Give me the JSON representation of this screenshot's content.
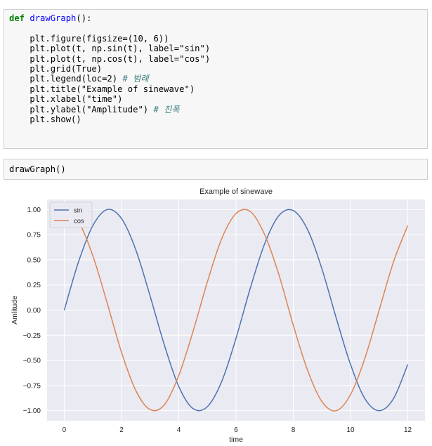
{
  "code_cell": {
    "def_kw": "def",
    "func_name": "drawGraph",
    "def_tail": "():",
    "l1": "plt.figure(figsize=(10, 6))",
    "l2": "plt.plot(t, np.sin(t), label=\"sin\")",
    "l3": "plt.plot(t, np.cos(t), label=\"cos\")",
    "l4": "plt.grid(True)",
    "l5_code": "plt.legend(loc=2) ",
    "l5_comment": "# 범례",
    "l6": "plt.title(\"Example of sinewave\")",
    "l7": "plt.xlabel(\"time\")",
    "l8_code": "plt.ylabel(\"Amplitude\") ",
    "l8_comment": "# 진폭",
    "l9": "plt.show()"
  },
  "run_cell": {
    "code": "drawGraph()"
  },
  "colors": {
    "sin": "#4c72b0",
    "cos": "#dd8452",
    "plot_bg": "#eaeaf2",
    "grid": "#ffffff"
  },
  "chart_data": {
    "type": "line",
    "title": "Example of sinewave",
    "xlabel": "time",
    "ylabel": "Amlitude",
    "xlim": [
      -0.6,
      12.6
    ],
    "ylim": [
      -1.1,
      1.1
    ],
    "xticks": [
      0,
      2,
      4,
      6,
      8,
      10,
      12
    ],
    "xtick_labels": [
      "0",
      "2",
      "4",
      "6",
      "8",
      "10",
      "12"
    ],
    "yticks": [
      -1.0,
      -0.75,
      -0.5,
      -0.25,
      0.0,
      0.25,
      0.5,
      0.75,
      1.0
    ],
    "ytick_labels": [
      "−1.00",
      "−0.75",
      "−0.50",
      "−0.25",
      "0.00",
      "0.25",
      "0.50",
      "0.75",
      "1.00"
    ],
    "grid": true,
    "legend_position": "top-left",
    "series": [
      {
        "name": "sin",
        "color": "#4c72b0",
        "x": [
          0,
          0.5,
          1,
          1.5,
          2,
          2.5,
          3,
          3.5,
          4,
          4.5,
          5,
          5.5,
          6,
          6.5,
          7,
          7.5,
          8,
          8.5,
          9,
          9.5,
          10,
          10.5,
          11,
          11.5,
          12
        ],
        "y": [
          0.0,
          0.48,
          0.84,
          1.0,
          0.91,
          0.6,
          0.14,
          -0.35,
          -0.76,
          -0.98,
          -0.96,
          -0.71,
          -0.28,
          0.22,
          0.66,
          0.94,
          0.99,
          0.8,
          0.41,
          -0.08,
          -0.54,
          -0.88,
          -1.0,
          -0.88,
          -0.54
        ]
      },
      {
        "name": "cos",
        "color": "#dd8452",
        "x": [
          0,
          0.5,
          1,
          1.5,
          2,
          2.5,
          3,
          3.5,
          4,
          4.5,
          5,
          5.5,
          6,
          6.5,
          7,
          7.5,
          8,
          8.5,
          9,
          9.5,
          10,
          10.5,
          11,
          11.5,
          12
        ],
        "y": [
          1.0,
          0.88,
          0.54,
          0.07,
          -0.42,
          -0.8,
          -0.99,
          -0.94,
          -0.65,
          -0.21,
          0.28,
          0.71,
          0.96,
          0.98,
          0.75,
          0.35,
          -0.15,
          -0.6,
          -0.91,
          -1.0,
          -0.84,
          -0.48,
          0.0,
          0.48,
          0.84
        ]
      }
    ]
  }
}
